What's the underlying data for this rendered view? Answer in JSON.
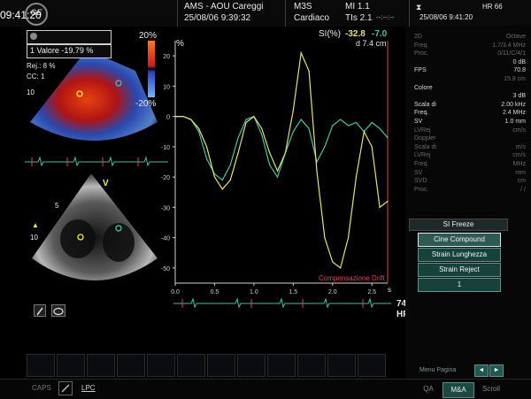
{
  "topbar": {
    "clock": "09:41:20",
    "logo": "GE",
    "institution": "AMS - AOU Careggi",
    "datetime": "25/08/06 9:39:32",
    "probe": "M3S",
    "preset": "Cardiaco",
    "mi": "MI 1.1",
    "tis": "TIs 2.1",
    "patient_id": "--:--:--",
    "right_datetime": "25/08/06 9:41:20",
    "hr_label": "HR 66"
  },
  "color_scale": {
    "top": "20%",
    "bottom": "-20%"
  },
  "readout": {
    "line1": "1 Valore -19.79 %",
    "rej": "Rej.: 8 %",
    "ccl": "CC: 1",
    "depth_tick": "10"
  },
  "bmode": {
    "marker_v": "V",
    "depth5": "5",
    "depth10": "10"
  },
  "plot": {
    "y_label": "%",
    "si_label": "SI(%)",
    "si_val1": "-32.8",
    "si_val2": "-7.0",
    "d_label": "d 7.4 cm",
    "x_unit": "s",
    "footer_text": "Compensazione Drift",
    "hr_value": "74",
    "hr_unit": "HR"
  },
  "chart_data": {
    "type": "line",
    "xlabel": "s",
    "ylabel": "%",
    "xlim": [
      0,
      2.7
    ],
    "ylim": [
      -55,
      25
    ],
    "x_ticks": [
      "0.0",
      "0.5",
      "1.0",
      "1.5",
      "2.0",
      "2.5"
    ],
    "y_ticks": [
      "20",
      "10",
      "0",
      "-10",
      "-20",
      "-30",
      "-40",
      "-50"
    ],
    "series": [
      {
        "color": "#3ec8a4",
        "x": [
          0.0,
          0.1,
          0.2,
          0.3,
          0.4,
          0.5,
          0.6,
          0.7,
          0.8,
          0.9,
          1.0,
          1.1,
          1.2,
          1.3,
          1.4,
          1.5,
          1.6,
          1.7,
          1.8,
          1.9,
          2.0,
          2.1,
          2.2,
          2.3,
          2.4,
          2.5,
          2.6,
          2.7
        ],
        "y": [
          0,
          0,
          -1,
          -5,
          -14,
          -19,
          -21,
          -16,
          -7,
          -1,
          0,
          -6,
          -16,
          -20,
          -12,
          -5,
          -1,
          -4,
          -15,
          -10,
          -3,
          -1,
          -3,
          -2,
          -5,
          -2,
          -4,
          -7
        ]
      },
      {
        "color": "#e6e26a",
        "x": [
          0.0,
          0.1,
          0.2,
          0.3,
          0.4,
          0.5,
          0.6,
          0.7,
          0.8,
          0.9,
          1.0,
          1.1,
          1.2,
          1.3,
          1.4,
          1.5,
          1.6,
          1.7,
          1.8,
          1.9,
          2.0,
          2.1,
          2.2,
          2.3,
          2.4,
          2.5,
          2.6,
          2.7
        ],
        "y": [
          0,
          0,
          -1,
          -4,
          -10,
          -20,
          -24,
          -21,
          -12,
          -2,
          0,
          -4,
          -12,
          -18,
          -12,
          2,
          21,
          15,
          -18,
          -40,
          -48,
          -50,
          -40,
          -20,
          -5,
          -10,
          -30,
          -28
        ]
      }
    ]
  },
  "right_panel": {
    "rows": [
      {
        "k": "2D",
        "v": "Octave",
        "dim": true
      },
      {
        "k": "Freq.",
        "v": "1.7/3.4 MHz",
        "dim": true
      },
      {
        "k": "Proc.",
        "v": "0/11/C/4/1",
        "dim": true
      },
      {
        "k": "",
        "v": "0 dB",
        "dim": false
      },
      {
        "k": "FPS",
        "v": "70.8",
        "dim": false
      },
      {
        "k": "",
        "v": "15.8 cm",
        "dim": true
      },
      {
        "k": "Colore",
        "v": "",
        "dim": false
      },
      {
        "k": "",
        "v": "3 dB",
        "dim": false
      },
      {
        "k": "Scala di",
        "v": "2.00 kHz",
        "dim": false
      },
      {
        "k": "Freq.",
        "v": "2.4 MHz",
        "dim": false
      },
      {
        "k": "SV",
        "v": "1.0 mm",
        "dim": false
      },
      {
        "k": "LVRej",
        "v": "cm/s",
        "dim": true
      },
      {
        "k": "Doppler",
        "v": "",
        "dim": true
      },
      {
        "k": "Scala di",
        "v": "m/s",
        "dim": true
      },
      {
        "k": "LVRej",
        "v": "cm/s",
        "dim": true
      },
      {
        "k": "Freq.",
        "v": "MHz",
        "dim": true
      },
      {
        "k": "SV",
        "v": "mm",
        "dim": true
      },
      {
        "k": "SVD",
        "v": "cm",
        "dim": true
      },
      {
        "k": "Proc.",
        "v": "/ /",
        "dim": true
      }
    ],
    "section_title": "SI Freeze",
    "buttons": [
      "Cine Compound",
      "Strain Lunghezza",
      "Strain Reject",
      "1"
    ],
    "page_label": "Menu Pagina",
    "page_prev": "◄",
    "page_next": "►"
  },
  "bottom_bar": {
    "caps": "CAPS",
    "lpc": "LPC",
    "tab_qa": "QA",
    "tab_mba": "M&A",
    "tab_scroll": "Scroll"
  }
}
